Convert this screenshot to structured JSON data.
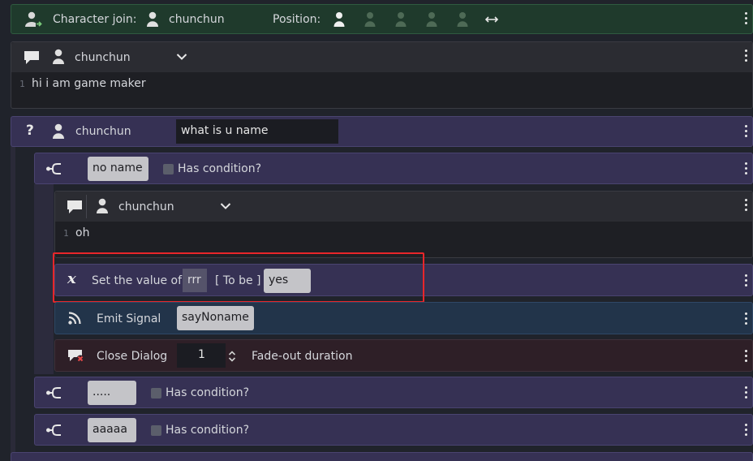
{
  "character_join": {
    "label": "Character join:",
    "character": "chunchun",
    "position_label": "Position:"
  },
  "text_event_1": {
    "character": "chunchun",
    "line_number": "1",
    "text": "hi i am game maker"
  },
  "question_event": {
    "icon": "?",
    "character": "chunchun",
    "question": "what is u name"
  },
  "choice_1": {
    "value": "no name",
    "has_condition_label": "Has condition?"
  },
  "text_event_2": {
    "character": "chunchun",
    "line_number": "1",
    "text": "oh"
  },
  "set_value_event": {
    "icon": "x",
    "label": "Set the value of",
    "variable": "rrr",
    "to_be_label": "[ To be ]",
    "value": "yes"
  },
  "emit_signal_event": {
    "label": "Emit Signal",
    "signal": "sayNoname"
  },
  "close_dialog_event": {
    "label": "Close Dialog",
    "duration": "1",
    "duration_label": "Fade-out duration"
  },
  "choice_2": {
    "value": ".....",
    "has_condition_label": "Has condition?"
  },
  "choice_3": {
    "value": "aaaaa",
    "has_condition_label": "Has condition?"
  },
  "colors": {
    "character_join_bg": "#1f3a2c",
    "question_bg": "#363154",
    "text_event_bg": "#2b2c32",
    "emit_signal_bg": "#22344a",
    "close_dialog_bg": "#2e1f27",
    "highlight_border": "#e8262a"
  }
}
